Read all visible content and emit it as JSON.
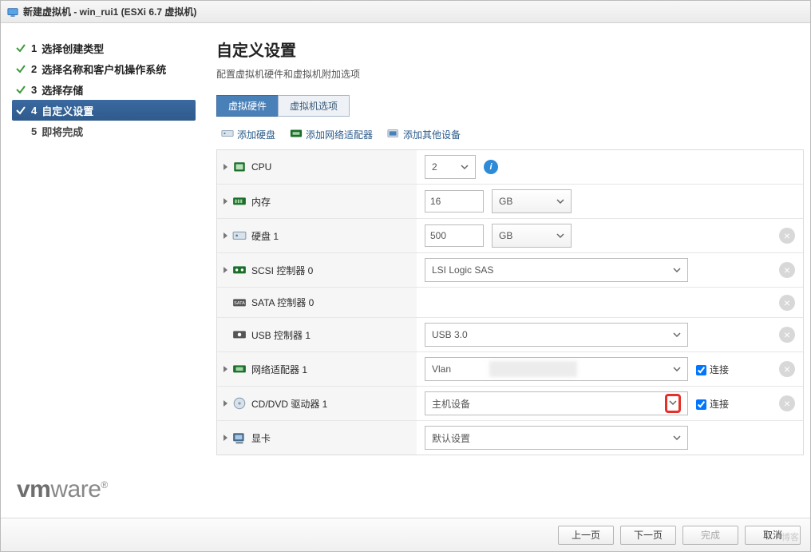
{
  "titlebar": {
    "text": "新建虚拟机 - win_rui1 (ESXi 6.7 虚拟机)"
  },
  "steps": [
    {
      "num": "1",
      "label": "选择创建类型",
      "state": "done"
    },
    {
      "num": "2",
      "label": "选择名称和客户机操作系统",
      "state": "done"
    },
    {
      "num": "3",
      "label": "选择存储",
      "state": "done"
    },
    {
      "num": "4",
      "label": "自定义设置",
      "state": "active"
    },
    {
      "num": "5",
      "label": "即将完成",
      "state": "pending"
    }
  ],
  "brand": "vmware",
  "header": {
    "title": "自定义设置",
    "subtitle": "配置虚拟机硬件和虚拟机附加选项"
  },
  "tabs": [
    {
      "label": "虚拟硬件",
      "active": true
    },
    {
      "label": "虚拟机选项",
      "active": false
    }
  ],
  "toolbar": {
    "add_disk": "添加硬盘",
    "add_nic": "添加网络适配器",
    "add_other": "添加其他设备"
  },
  "rows": {
    "cpu": {
      "label": "CPU",
      "value": "2"
    },
    "memory": {
      "label": "内存",
      "value": "16",
      "unit": "GB"
    },
    "disk": {
      "label": "硬盘 1",
      "value": "500",
      "unit": "GB"
    },
    "scsi": {
      "label": "SCSI 控制器 0",
      "value": "LSI Logic SAS"
    },
    "sata": {
      "label": "SATA 控制器 0"
    },
    "usb": {
      "label": "USB 控制器 1",
      "value": "USB 3.0"
    },
    "nic": {
      "label": "网络适配器 1",
      "value": "Vlan",
      "connect_label": "连接"
    },
    "cdrom": {
      "label": "CD/DVD 驱动器 1",
      "value": "主机设备",
      "connect_label": "连接"
    },
    "gpu": {
      "label": "显卡",
      "value": "默认设置"
    }
  },
  "footer": {
    "prev": "上一页",
    "next": "下一页",
    "finish": "完成",
    "cancel": "取消"
  },
  "watermark": "博客"
}
